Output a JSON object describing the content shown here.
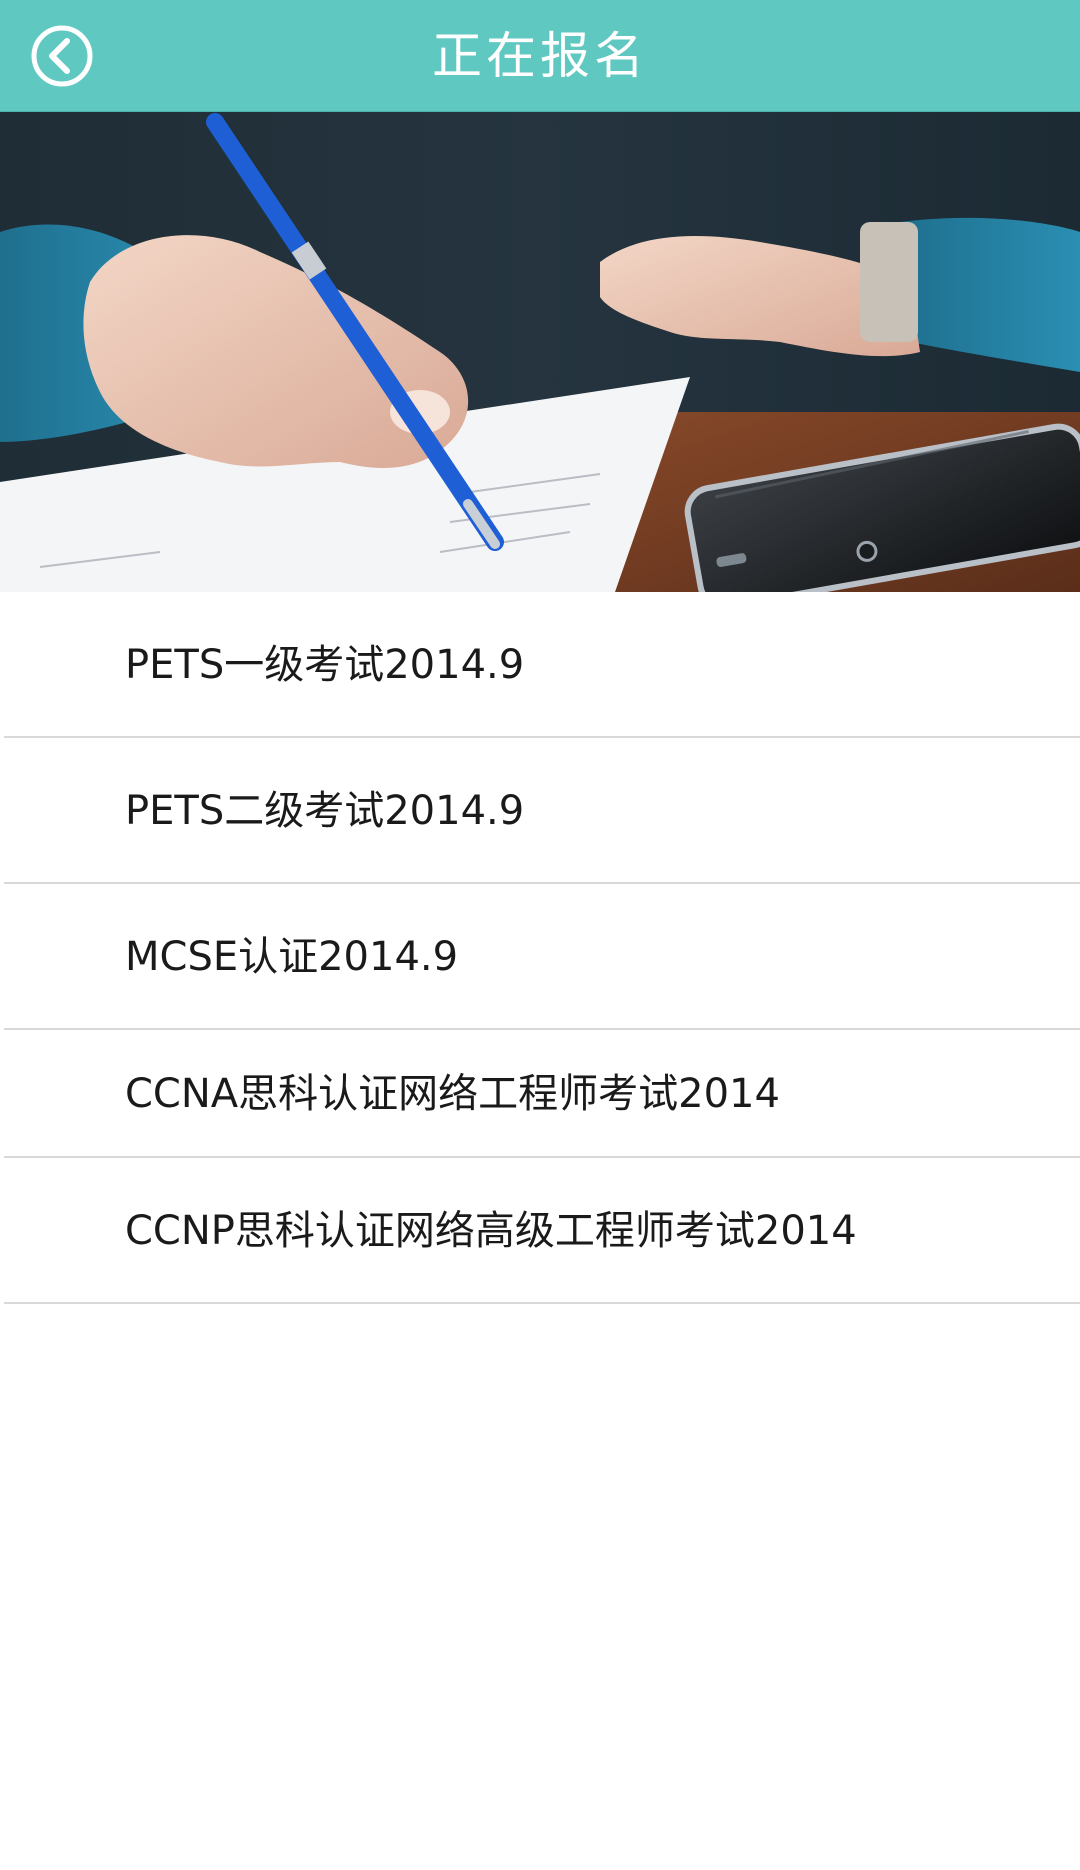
{
  "header": {
    "title": "正在报名",
    "back_icon": "chevron-left-circle-icon",
    "background_color": "#5fc8c0"
  },
  "banner": {
    "image": "photo-hand-writing-with-blue-pen-and-smartphone"
  },
  "list": {
    "items": [
      {
        "label": "PETS一级考试2014.9"
      },
      {
        "label": "PETS二级考试2014.9"
      },
      {
        "label": "MCSE认证2014.9"
      },
      {
        "label": "CCNA思科认证网络工程师考试2014"
      },
      {
        "label": "CCNP思科认证网络高级工程师考试2014"
      }
    ]
  }
}
